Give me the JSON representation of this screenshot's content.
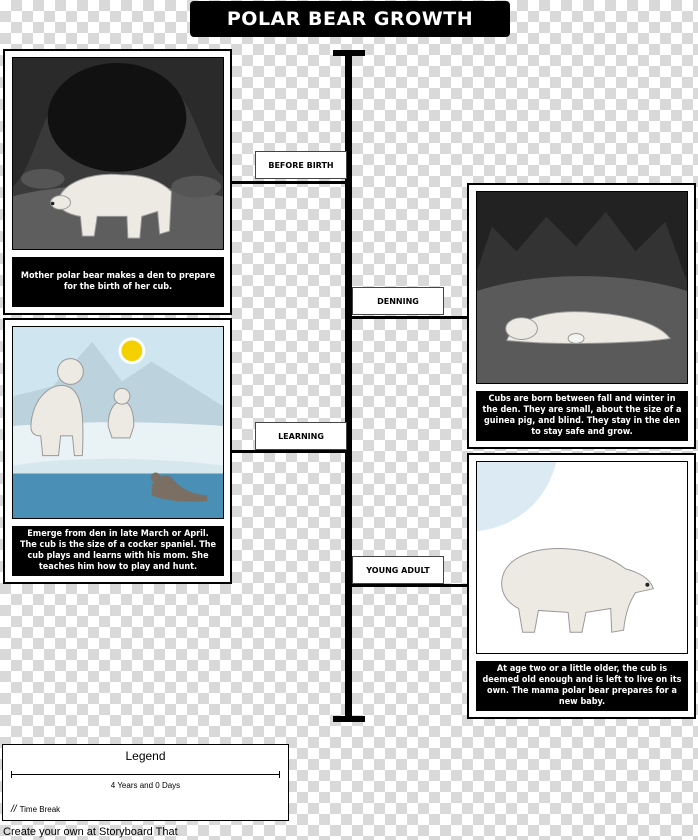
{
  "title": "POLAR BEAR GROWTH",
  "timeline": {
    "labels": [
      "BEFORE BIRTH",
      "DENNING",
      "LEARNING",
      "YOUNG ADULT"
    ]
  },
  "panels": [
    {
      "scene": "mother bear in cave",
      "caption": "Mother polar bear makes a den to prepare for the birth of her cub."
    },
    {
      "scene": "bear with cub sleeping in den",
      "caption": "Cubs are born between fall and winter in the den. They are small, about the size of a guinea pig, and blind. They stay in the den to stay safe and grow."
    },
    {
      "scene": "mother and cub on ice with seal",
      "caption": "Emerge from den in late March or April. The cub is the size of a cocker spaniel. The cub plays and learns with his mom. She teaches him how to play and hunt."
    },
    {
      "scene": "young adult bear walking",
      "caption": "At age two or a little older, the cub is deemed old enough and is left to live on its own. The mama polar bear prepares for a new baby."
    }
  ],
  "legend": {
    "title": "Legend",
    "duration": "4 Years and 0 Days",
    "break_symbol": "//",
    "break_label": "Time Break"
  },
  "footer": "Create your own at Storyboard That",
  "colors": {
    "title_bg": "#000000",
    "caption_bg": "#000000",
    "caption_text": "#ffffff"
  }
}
